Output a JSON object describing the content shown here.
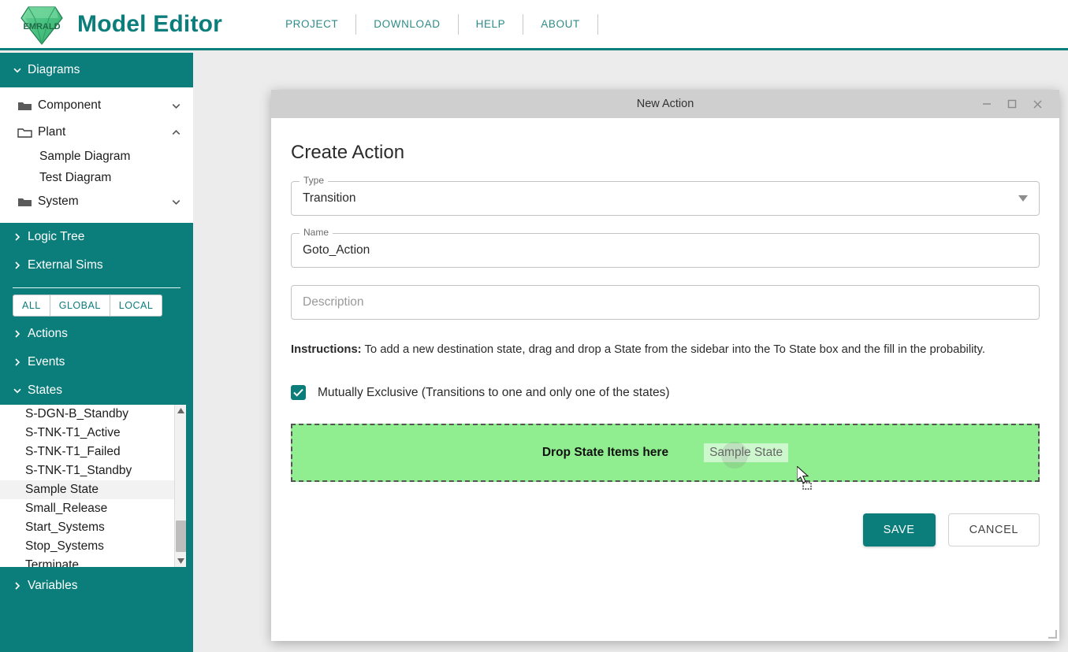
{
  "header": {
    "logo_alt": "EMRALD",
    "logo_text": "EMRALD",
    "title": "Model Editor",
    "nav": [
      {
        "label": "PROJECT"
      },
      {
        "label": "DOWNLOAD"
      },
      {
        "label": "HELP"
      },
      {
        "label": "ABOUT"
      }
    ],
    "accent_color": "#0b7d7b"
  },
  "sidebar": {
    "diagrams": {
      "label": "Diagrams",
      "expanded": true,
      "folders": [
        {
          "label": "Component",
          "expanded": false,
          "children": []
        },
        {
          "label": "Plant",
          "expanded": true,
          "children": [
            {
              "label": "Sample Diagram"
            },
            {
              "label": "Test Diagram"
            }
          ]
        },
        {
          "label": "System",
          "expanded": false,
          "children": []
        }
      ]
    },
    "logic_tree": {
      "label": "Logic Tree",
      "expanded": false
    },
    "external_sims": {
      "label": "External Sims",
      "expanded": false
    },
    "scope_filter": {
      "options": [
        "ALL",
        "GLOBAL",
        "LOCAL"
      ],
      "selected": "ALL"
    },
    "actions": {
      "label": "Actions",
      "expanded": false
    },
    "events": {
      "label": "Events",
      "expanded": false
    },
    "states": {
      "label": "States",
      "expanded": true,
      "items": [
        {
          "label": "S-DGN-B_Standby",
          "selected": false
        },
        {
          "label": "S-TNK-T1_Active",
          "selected": false
        },
        {
          "label": "S-TNK-T1_Failed",
          "selected": false
        },
        {
          "label": "S-TNK-T1_Standby",
          "selected": false
        },
        {
          "label": "Sample State",
          "selected": true
        },
        {
          "label": "Small_Release",
          "selected": false
        },
        {
          "label": "Start_Systems",
          "selected": false
        },
        {
          "label": "Stop_Systems",
          "selected": false
        },
        {
          "label": "Terminate",
          "selected": false
        }
      ]
    },
    "variables": {
      "label": "Variables",
      "expanded": false
    }
  },
  "dialog": {
    "window_title": "New Action",
    "heading": "Create Action",
    "type_field": {
      "label": "Type",
      "value": "Transition"
    },
    "name_field": {
      "label": "Name",
      "value": "Goto_Action"
    },
    "description_field": {
      "placeholder": "Description",
      "value": ""
    },
    "instructions_label": "Instructions:",
    "instructions_text": " To add a new destination state, drag and drop a State from the sidebar into the To State box and the fill in the probability.",
    "mutually_exclusive": {
      "label": "Mutually Exclusive (Transitions to one and only one of the states)",
      "checked": true
    },
    "dropzone": {
      "label": "Drop State Items here",
      "dragged_item": "Sample State",
      "background_color": "#90ee90"
    },
    "save_label": "SAVE",
    "cancel_label": "CANCEL"
  }
}
